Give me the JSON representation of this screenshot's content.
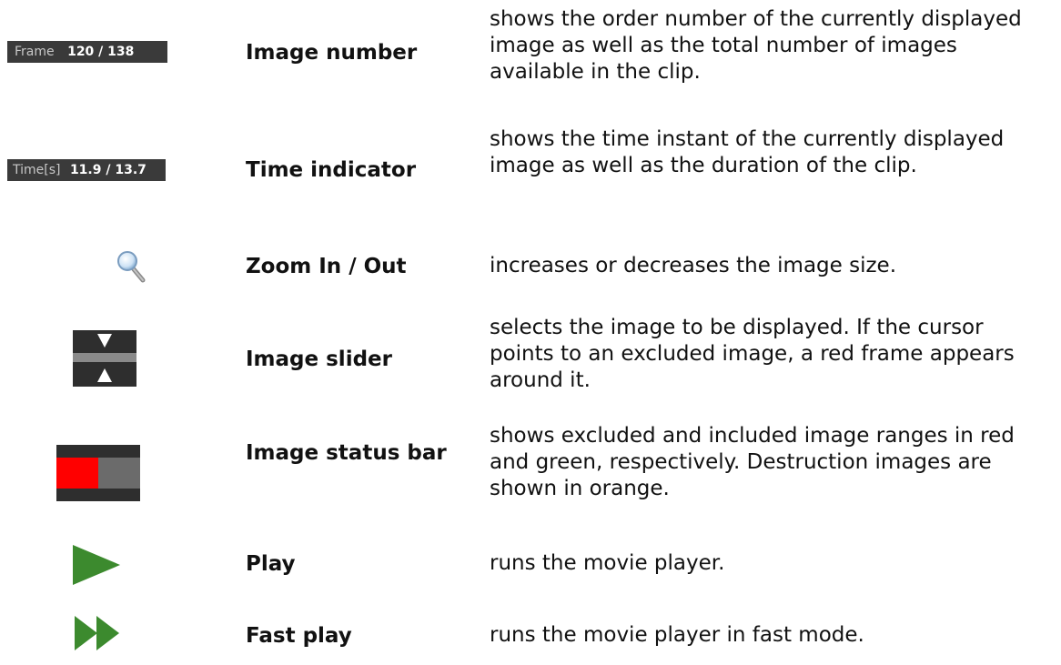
{
  "colors": {
    "widget_bg": "#3a3a3a",
    "excluded": "#ff0000",
    "included_track": "#6b6b6b",
    "play_green": "#3c8a2e"
  },
  "rows": [
    {
      "icon": "frame-counter",
      "counter_label": "Frame",
      "counter_value": "120 / 138",
      "term": "Image number",
      "desc": "shows the order number of the currently displayed image as well as the total number of images available in the clip."
    },
    {
      "icon": "time-counter",
      "counter_label": "Time[s]",
      "counter_value": "11.9 / 13.7",
      "term": "Time indicator",
      "desc": "shows the time instant of the currently displayed image as well as the duration of the clip."
    },
    {
      "icon": "magnifier-icon",
      "term": "Zoom In / Out",
      "desc": "increases or decreases the image size."
    },
    {
      "icon": "slider-icon",
      "term": "Image slider",
      "desc": "selects the image to be displayed. If the cursor points to an excluded image, a red frame appears around it."
    },
    {
      "icon": "status-bar-icon",
      "term": "Image status bar",
      "desc": "shows excluded and included image ranges in red and green, respectively. Destruction images are shown in orange."
    },
    {
      "icon": "play-icon",
      "term": "Play",
      "desc": "runs the movie player."
    },
    {
      "icon": "fast-play-icon",
      "term": "Fast play",
      "desc": "runs the movie player in fast mode."
    }
  ]
}
